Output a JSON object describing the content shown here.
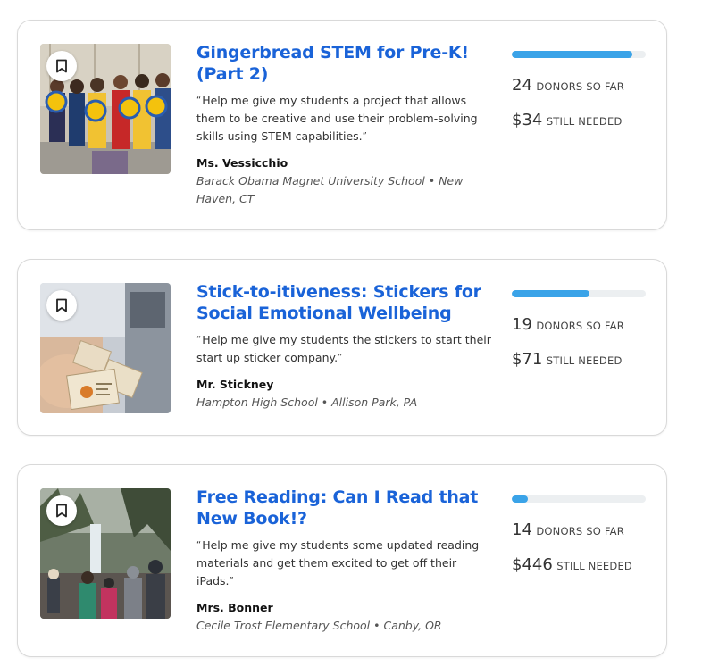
{
  "projects": [
    {
      "title": "Gingerbread STEM for Pre-K! (Part 2)",
      "quote": "Help me give my students a project that allows them to be creative and use their problem-solving skills using STEM capabilities.",
      "teacher": "Ms. Vessicchio",
      "school": "Barack Obama Magnet University School • New Haven, CT",
      "progress_fraction": 0.9,
      "donors_count": "24",
      "donors_label": "DONORS SO FAR",
      "needed_amount": "$34",
      "needed_label": "STILL NEEDED",
      "bookmark_icon": "bookmark-icon"
    },
    {
      "title": "Stick-to-itiveness: Stickers for Social Emotional Wellbeing",
      "quote": "Help me give my students the stickers to start their start up sticker company.",
      "teacher": "Mr. Stickney",
      "school": "Hampton High School • Allison Park, PA",
      "progress_fraction": 0.58,
      "donors_count": "19",
      "donors_label": "DONORS SO FAR",
      "needed_amount": "$71",
      "needed_label": "STILL NEEDED",
      "bookmark_icon": "bookmark-icon"
    },
    {
      "title": "Free Reading: Can I Read that New Book!?",
      "quote": "Help me give my students some updated reading materials and get them excited to get off their iPads.",
      "teacher": "Mrs. Bonner",
      "school": "Cecile Trost Elementary School • Canby, OR",
      "progress_fraction": 0.12,
      "donors_count": "14",
      "donors_label": "DONORS SO FAR",
      "needed_amount": "$446",
      "needed_label": "STILL NEEDED",
      "bookmark_icon": "bookmark-icon"
    }
  ],
  "colors": {
    "title": "#1a63d8",
    "progress": "#3aa3e8",
    "progress_track": "#eceff1",
    "card_border": "#d9d9d9"
  }
}
